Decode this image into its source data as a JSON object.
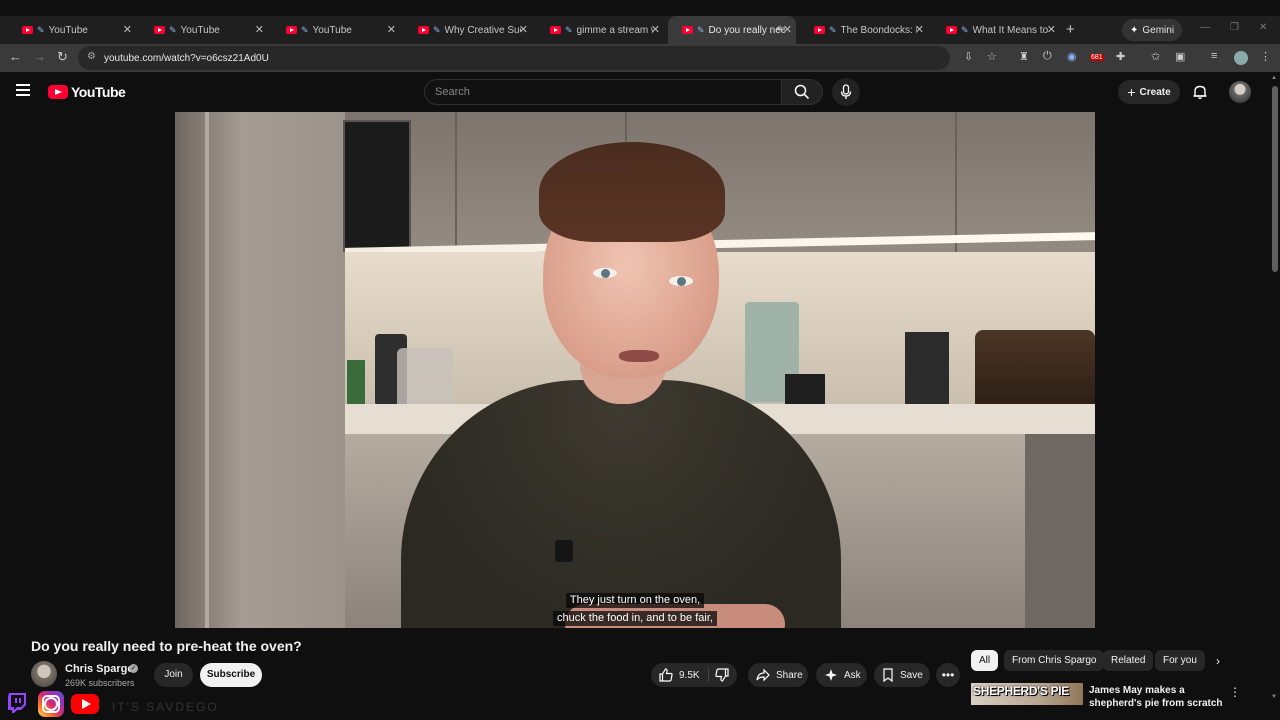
{
  "browser": {
    "tabs": [
      {
        "title": "YouTube",
        "kind": "youtube"
      },
      {
        "title": "YouTube",
        "kind": "youtube"
      },
      {
        "title": "YouTube",
        "kind": "youtube"
      },
      {
        "title": "Why Creative Succe",
        "kind": "youtube"
      },
      {
        "title": "gimme a stream wi",
        "kind": "youtube"
      },
      {
        "title": "Do you really need",
        "kind": "youtube",
        "active": true,
        "audible": true
      },
      {
        "title": "The Boondocks: Fiv",
        "kind": "youtube"
      },
      {
        "title": "What It Means to b",
        "kind": "youtube"
      }
    ],
    "gemini_label": "Gemini",
    "url": "youtube.com/watch?v=o6csz21Ad0U",
    "extension_badge": "681"
  },
  "masthead": {
    "logo_text": "YouTube",
    "search_placeholder": "Search",
    "create_label": "Create"
  },
  "video": {
    "caption_lines": [
      "They just turn on the oven,",
      "chuck the food in, and to be fair,"
    ]
  },
  "watch": {
    "title": "Do you really need to pre-heat the oven?",
    "channel_name": "Chris Spargo",
    "subscribers": "269K subscribers",
    "join_label": "Join",
    "subscribe_label": "Subscribe",
    "like_count": "9.5K",
    "share_label": "Share",
    "ask_label": "Ask",
    "save_label": "Save"
  },
  "chips": [
    "All",
    "From Chris Spargo",
    "Related",
    "For you"
  ],
  "recommended": [
    {
      "thumb_text": "SHEPHERD'S PIE",
      "title": "James May makes a shepherd's pie from scratch"
    }
  ],
  "overlay_faded_text": "IT'S SAVDEGO"
}
